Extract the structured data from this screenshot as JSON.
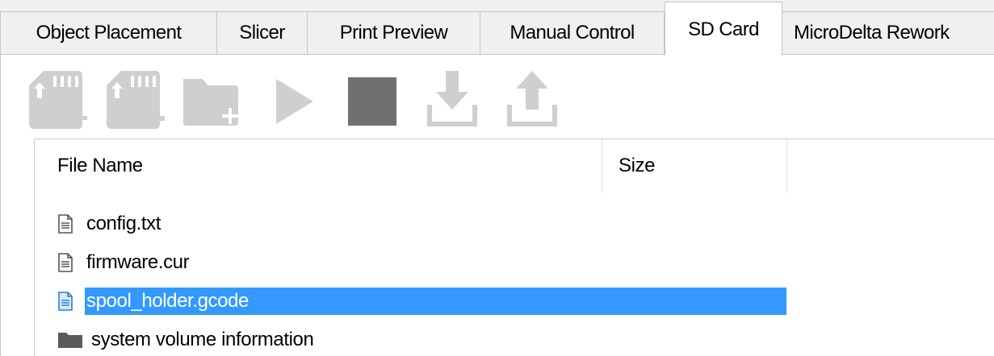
{
  "tabs": [
    {
      "label": "Object Placement",
      "active": false
    },
    {
      "label": "Slicer",
      "active": false
    },
    {
      "label": "Print Preview",
      "active": false
    },
    {
      "label": "Manual Control",
      "active": false
    },
    {
      "label": "SD Card",
      "active": true
    },
    {
      "label": "MicroDelta Rework",
      "active": false
    }
  ],
  "toolbar": {
    "buttons": [
      {
        "icon": "sd-card-add-icon",
        "enabled": false
      },
      {
        "icon": "sd-card-remove-icon",
        "enabled": false
      },
      {
        "icon": "new-folder-icon",
        "enabled": false
      },
      {
        "icon": "play-icon",
        "enabled": false
      },
      {
        "icon": "stop-icon",
        "enabled": true
      },
      {
        "icon": "download-icon",
        "enabled": false
      },
      {
        "icon": "upload-icon",
        "enabled": false
      }
    ]
  },
  "file_list": {
    "columns": [
      "File Name",
      "Size"
    ],
    "rows": [
      {
        "name": "config.txt",
        "type": "file",
        "size": "",
        "selected": false
      },
      {
        "name": "firmware.cur",
        "type": "file",
        "size": "",
        "selected": false
      },
      {
        "name": "spool_holder.gcode",
        "type": "file",
        "size": "",
        "selected": true
      },
      {
        "name": "system volume information",
        "type": "folder",
        "size": "",
        "selected": false
      }
    ]
  },
  "colors": {
    "selection": "#3399ff",
    "disabled_icon": "#cfcfcf",
    "enabled_icon": "#707070"
  }
}
